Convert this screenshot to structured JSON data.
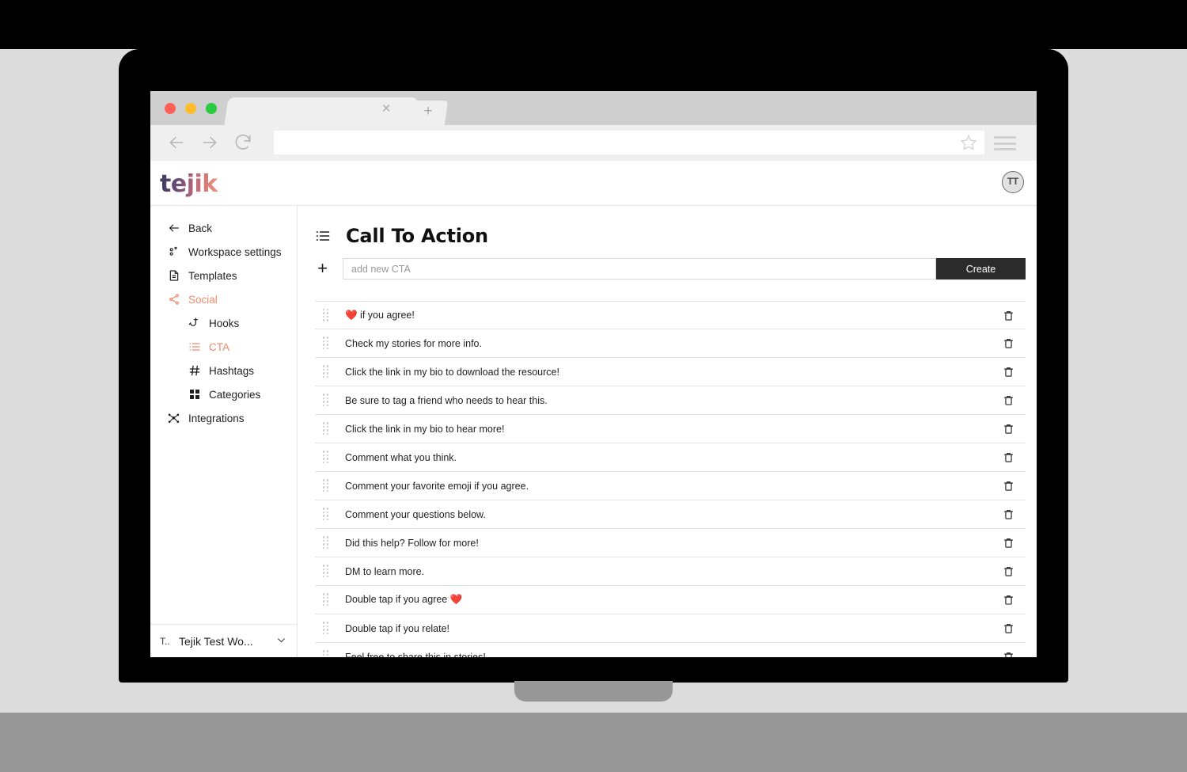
{
  "browser": {
    "tab_close_label": "×",
    "new_tab_label": "+",
    "url_value": "",
    "url_placeholder": ""
  },
  "app": {
    "logo_text": "tejik",
    "user_avatar_initials": "TT",
    "accent_color": "#f08a6e"
  },
  "sidebar": {
    "items": [
      {
        "label": "Back",
        "icon": "arrow-left-icon",
        "level": 0,
        "active": false
      },
      {
        "label": "Workspace settings",
        "icon": "workspace-settings-icon",
        "level": 0,
        "active": false
      },
      {
        "label": "Templates",
        "icon": "document-icon",
        "level": 0,
        "active": false
      },
      {
        "label": "Social",
        "icon": "share-icon",
        "level": 0,
        "active": true
      },
      {
        "label": "Hooks",
        "icon": "fish-hook-icon",
        "level": 1,
        "active": false
      },
      {
        "label": "CTA",
        "icon": "list-icon",
        "level": 1,
        "active": true
      },
      {
        "label": "Hashtags",
        "icon": "hashtag-icon",
        "level": 1,
        "active": false
      },
      {
        "label": "Categories",
        "icon": "grid-icon",
        "level": 1,
        "active": false
      },
      {
        "label": "Integrations",
        "icon": "integrations-icon",
        "level": 0,
        "active": false
      }
    ],
    "workspace": {
      "avatar_label": "T..",
      "name": "Tejik Test Wo...",
      "chevron": "⌄"
    }
  },
  "main": {
    "page_title": "Call To Action",
    "page_title_icon": "list-icon",
    "add": {
      "plus_label": "+",
      "input_value": "",
      "input_placeholder": "add new CTA",
      "create_label": "Create"
    },
    "cta_items": [
      {
        "text": "❤️ if you agree!"
      },
      {
        "text": "Check my stories for more info."
      },
      {
        "text": "Click the link in my bio to download the resource!"
      },
      {
        "text": "Be sure to tag a friend who needs to hear this."
      },
      {
        "text": "Click the link in my bio to hear more!"
      },
      {
        "text": "Comment what you think."
      },
      {
        "text": "Comment your favorite emoji if you agree."
      },
      {
        "text": "Comment your questions below."
      },
      {
        "text": "Did this help? Follow for more!"
      },
      {
        "text": "DM to learn more."
      },
      {
        "text": "Double tap if you agree ❤️"
      },
      {
        "text": "Double tap if you relate!"
      },
      {
        "text": "Feel free to share this in stories!"
      }
    ]
  }
}
